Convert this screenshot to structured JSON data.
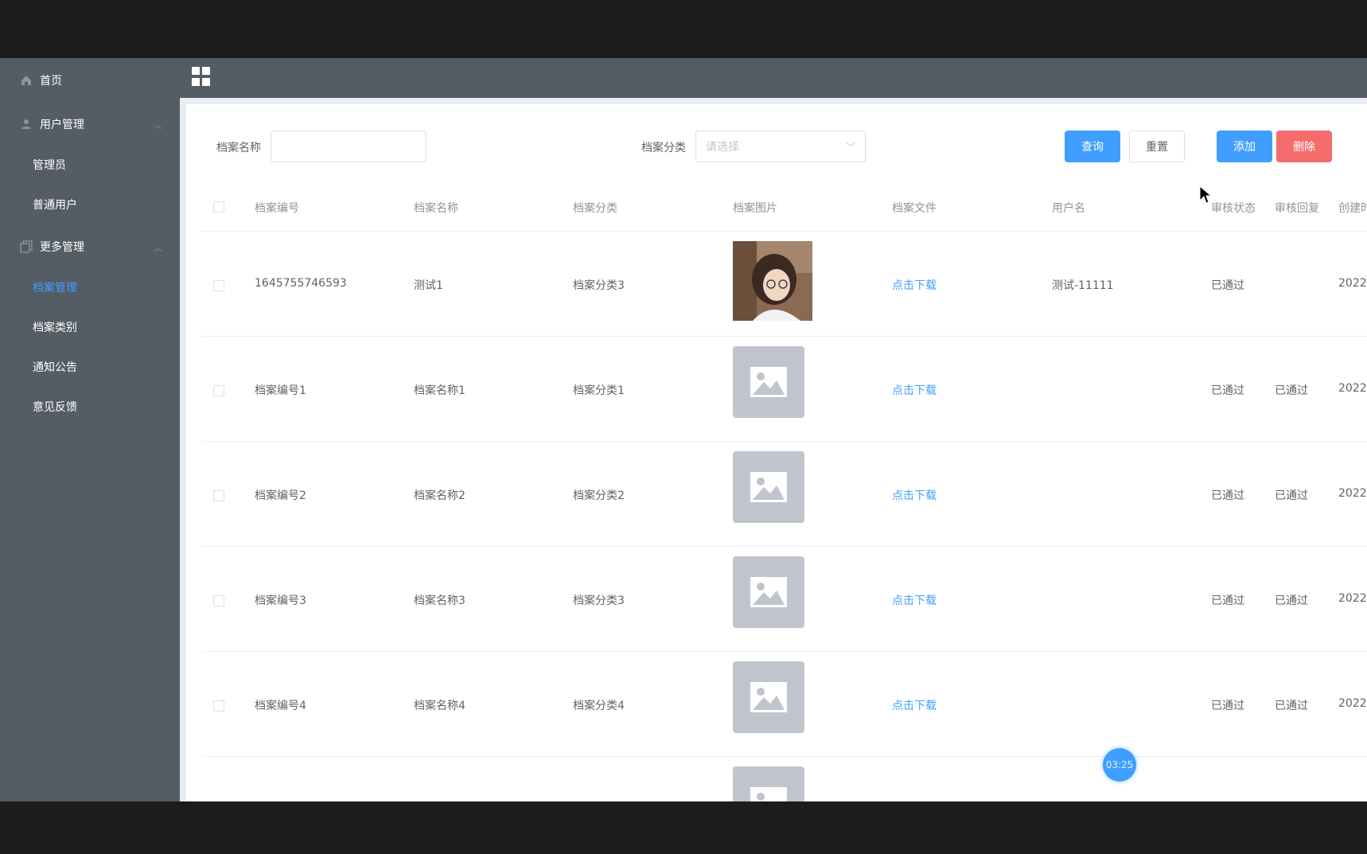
{
  "sidebar": {
    "home": "首页",
    "user_mgmt": "用户管理",
    "admin": "管理员",
    "normal_user": "普通用户",
    "more_mgmt": "更多管理",
    "archive_mgmt": "档案管理",
    "archive_category": "档案类别",
    "notice": "通知公告",
    "feedback": "意见反馈"
  },
  "search": {
    "name_label": "档案名称",
    "name_value": "",
    "category_label": "档案分类",
    "category_placeholder": "请选择"
  },
  "buttons": {
    "query": "查询",
    "reset": "重置",
    "add": "添加",
    "delete": "删除"
  },
  "table": {
    "headers": [
      "档案编号",
      "档案名称",
      "档案分类",
      "档案图片",
      "档案文件",
      "用户名",
      "审核状态",
      "审核回复",
      "创建时"
    ],
    "rows": [
      {
        "id": "1645755746593",
        "name": "测试1",
        "category": "档案分类3",
        "file": "点击下载",
        "user": "测试-11111",
        "status": "已通过",
        "reply": "",
        "created": "2022-",
        "has_photo": true
      },
      {
        "id": "档案编号1",
        "name": "档案名称1",
        "category": "档案分类1",
        "file": "点击下载",
        "user": "",
        "status": "已通过",
        "reply": "已通过",
        "created": "2022-",
        "has_photo": false
      },
      {
        "id": "档案编号2",
        "name": "档案名称2",
        "category": "档案分类2",
        "file": "点击下载",
        "user": "",
        "status": "已通过",
        "reply": "已通过",
        "created": "2022-",
        "has_photo": false
      },
      {
        "id": "档案编号3",
        "name": "档案名称3",
        "category": "档案分类3",
        "file": "点击下载",
        "user": "",
        "status": "已通过",
        "reply": "已通过",
        "created": "2022-",
        "has_photo": false
      },
      {
        "id": "档案编号4",
        "name": "档案名称4",
        "category": "档案分类4",
        "file": "点击下载",
        "user": "",
        "status": "已通过",
        "reply": "已通过",
        "created": "2022-",
        "has_photo": false
      }
    ]
  },
  "timer": "03:25",
  "colors": {
    "sidebar_bg": "#545c64",
    "accent": "#409eff",
    "danger": "#f56c6c"
  }
}
